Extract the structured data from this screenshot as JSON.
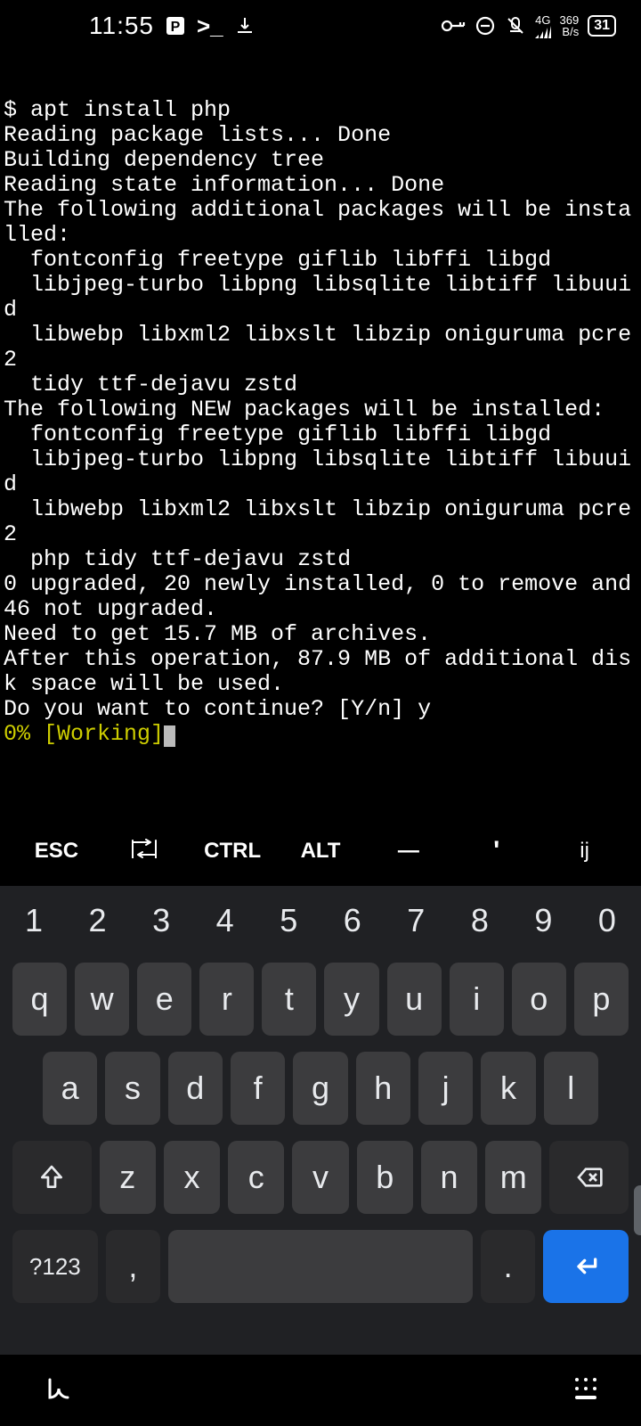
{
  "status": {
    "time": "11:55",
    "net_speed_top": "369",
    "net_speed_bottom": "B/s",
    "net_gen": "4G",
    "battery": "31"
  },
  "terminal": {
    "lines": [
      "$ apt install php",
      "Reading package lists... Done",
      "Building dependency tree",
      "Reading state information... Done",
      "The following additional packages will be installed:",
      "  fontconfig freetype giflib libffi libgd",
      "  libjpeg-turbo libpng libsqlite libtiff libuuid",
      "  libwebp libxml2 libxslt libzip oniguruma pcre2",
      "  tidy ttf-dejavu zstd",
      "The following NEW packages will be installed:",
      "  fontconfig freetype giflib libffi libgd",
      "  libjpeg-turbo libpng libsqlite libtiff libuuid",
      "  libwebp libxml2 libxslt libzip oniguruma pcre2",
      "  php tidy ttf-dejavu zstd",
      "0 upgraded, 20 newly installed, 0 to remove and 46 not upgraded.",
      "Need to get 15.7 MB of archives.",
      "After this operation, 87.9 MB of additional disk space will be used.",
      "Do you want to continue? [Y/n] y"
    ],
    "progress": "0% [Working]"
  },
  "extra_keys": {
    "esc": "ESC",
    "tab": "⇥",
    "ctrl": "CTRL",
    "alt": "ALT",
    "dash": "—",
    "quote": "'",
    "ij": "ij"
  },
  "keyboard": {
    "numbers": [
      "1",
      "2",
      "3",
      "4",
      "5",
      "6",
      "7",
      "8",
      "9",
      "0"
    ],
    "row1": [
      "q",
      "w",
      "e",
      "r",
      "t",
      "y",
      "u",
      "i",
      "o",
      "p"
    ],
    "row2": [
      "a",
      "s",
      "d",
      "f",
      "g",
      "h",
      "j",
      "k",
      "l"
    ],
    "row3": [
      "z",
      "x",
      "c",
      "v",
      "b",
      "n",
      "m"
    ],
    "symbols": "?123",
    "comma": ",",
    "period": "."
  }
}
